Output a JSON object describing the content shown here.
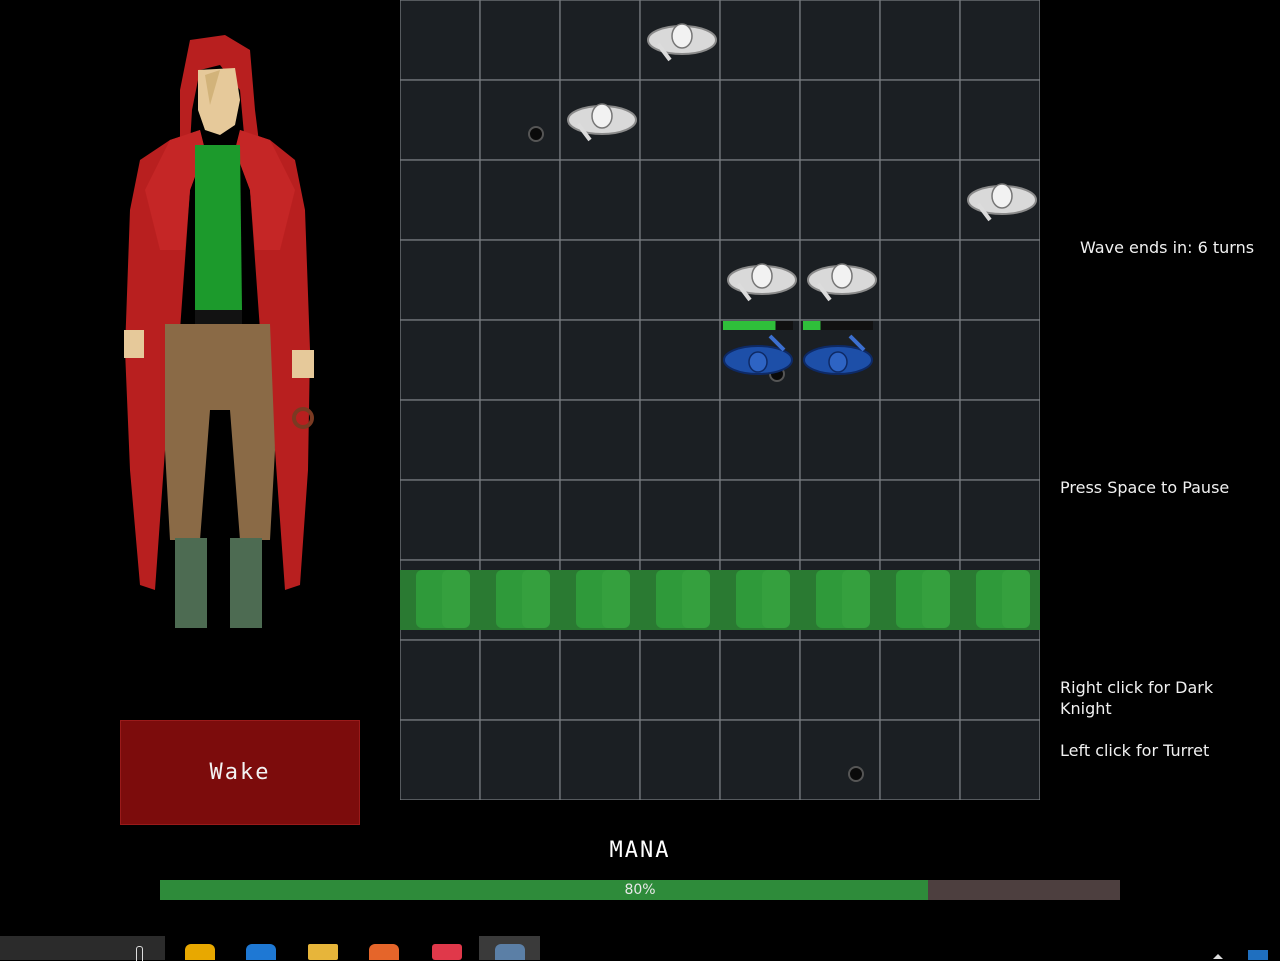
{
  "portrait": {
    "icon": "hooded-woman-portrait"
  },
  "wake_button": {
    "label": "Wake"
  },
  "board": {
    "columns": 8,
    "rows": 10,
    "barrier_row": 7,
    "enemies": [
      {
        "col": 3,
        "row": 0
      },
      {
        "col": 2,
        "row": 1
      },
      {
        "col": 7,
        "row": 2
      },
      {
        "col": 4,
        "row": 3
      },
      {
        "col": 5,
        "row": 3
      }
    ],
    "allies": [
      {
        "col": 4,
        "row": 4,
        "health": 0.75
      },
      {
        "col": 5,
        "row": 4,
        "health": 0.25
      }
    ],
    "holes": [
      {
        "col": 1,
        "row": 1
      },
      {
        "col": 4,
        "row": 4
      },
      {
        "col": 5,
        "row": 9
      }
    ]
  },
  "info": {
    "wave": "Wave ends in: 6 turns",
    "pause": "Press Space to Pause",
    "right_click": "Right click for Dark Knight",
    "left_click": "Left click for Turret"
  },
  "mana": {
    "label": "MANA",
    "value": 0.8,
    "percent_text": "80%"
  },
  "colors": {
    "accent_green": "#2e8b3a",
    "wake_red": "#7c0c0c",
    "board_bg": "#1b1f23",
    "ally_blue": "#1d4fa8"
  },
  "taskbar": {
    "icons": [
      "search-box",
      "warning-app-icon",
      "edge-browser-icon",
      "file-explorer-icon",
      "firefox-icon",
      "red-app-icon",
      "settings-gear-icon"
    ]
  }
}
